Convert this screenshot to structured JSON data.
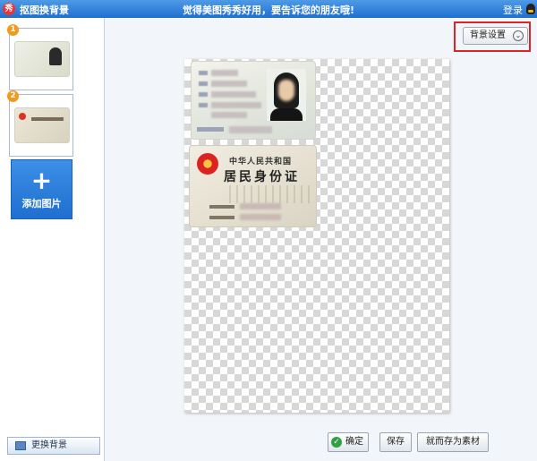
{
  "titlebar": {
    "logo_glyph": "秀",
    "title": "抠图换背景",
    "slogan": "觉得美图秀秀好用，要告诉您的朋友哦!",
    "login": "登录"
  },
  "sidebar": {
    "thumbnails": [
      {
        "badge": "1"
      },
      {
        "badge": "2"
      }
    ],
    "add_image_label": "添加图片",
    "add_image_icon": "+",
    "change_bg_label": "更换背景"
  },
  "main": {
    "bg_settings_label": "背景设置",
    "bg_settings_icon": "⌄",
    "id_back": {
      "line1": "中华人民共和国",
      "line2": "居民身份证"
    }
  },
  "actions": {
    "confirm_icon": "✓",
    "confirm": "确定",
    "save": "保存",
    "save_as": "就而存为素材"
  },
  "colors": {
    "title_bar": "#2f7fd8",
    "add_button": "#2b7fdd",
    "highlight": "#e02424"
  }
}
